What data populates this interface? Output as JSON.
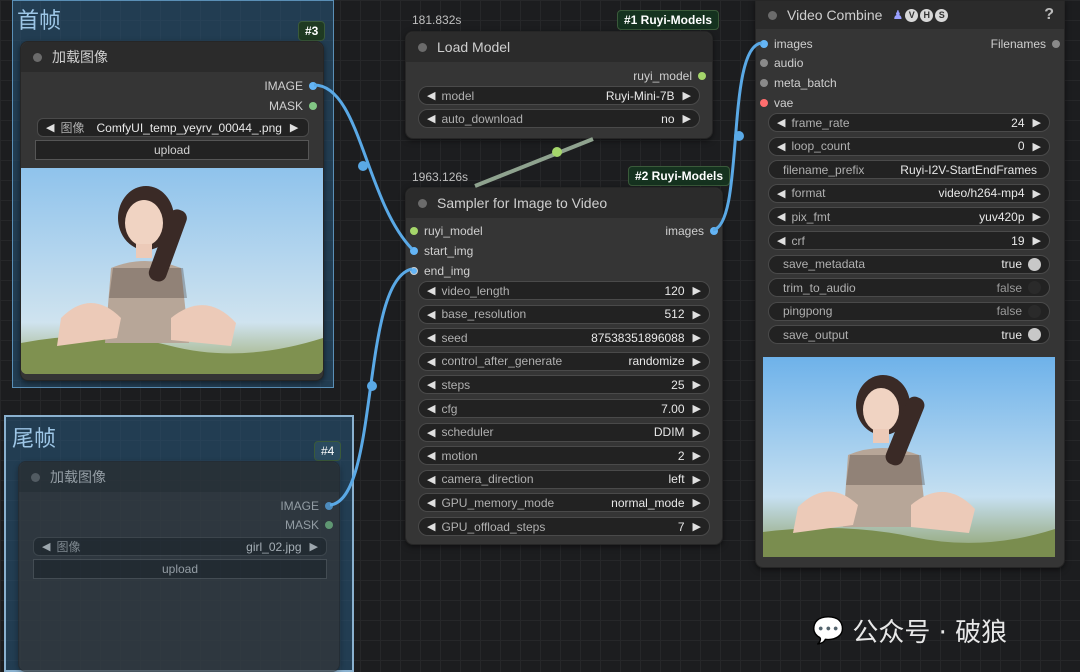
{
  "groups": {
    "first_frame": {
      "title": "首帧",
      "id_badge": "#3"
    },
    "last_frame": {
      "title": "尾帧",
      "id_badge": "#4"
    }
  },
  "load_image_1": {
    "title": "加载图像",
    "outputs": [
      "IMAGE",
      "MASK"
    ],
    "image_widget": {
      "label": "图像",
      "value": "ComfyUI_temp_yeyrv_00044_.png"
    },
    "upload_label": "upload"
  },
  "load_image_2": {
    "title": "加载图像",
    "outputs": [
      "IMAGE",
      "MASK"
    ],
    "image_widget": {
      "label": "图像",
      "value": "girl_02.jpg"
    },
    "upload_label": "upload"
  },
  "load_model": {
    "time": "181.832s",
    "badge": "#1 Ruyi-Models",
    "title": "Load Model",
    "output": "ruyi_model",
    "widgets": [
      {
        "label": "model",
        "value": "Ruyi-Mini-7B"
      },
      {
        "label": "auto_download",
        "value": "no"
      }
    ]
  },
  "sampler": {
    "time": "1963.126s",
    "badge": "#2 Ruyi-Models",
    "title": "Sampler for Image to Video",
    "inputs": [
      "ruyi_model",
      "start_img",
      "end_img"
    ],
    "output": "images",
    "widgets": [
      {
        "label": "video_length",
        "value": "120"
      },
      {
        "label": "base_resolution",
        "value": "512"
      },
      {
        "label": "seed",
        "value": "87538351896088"
      },
      {
        "label": "control_after_generate",
        "value": "randomize"
      },
      {
        "label": "steps",
        "value": "25"
      },
      {
        "label": "cfg",
        "value": "7.00"
      },
      {
        "label": "scheduler",
        "value": "DDIM"
      },
      {
        "label": "motion",
        "value": "2"
      },
      {
        "label": "camera_direction",
        "value": "left"
      },
      {
        "label": "GPU_memory_mode",
        "value": "normal_mode"
      },
      {
        "label": "GPU_offload_steps",
        "value": "7"
      }
    ]
  },
  "video_combine": {
    "title": "Video Combine",
    "badges": [
      "V",
      "H",
      "S"
    ],
    "help": "?",
    "inputs": [
      "images",
      "audio",
      "meta_batch",
      "vae"
    ],
    "output": "Filenames",
    "widgets": [
      {
        "label": "frame_rate",
        "value": "24",
        "kind": "number"
      },
      {
        "label": "loop_count",
        "value": "0",
        "kind": "number"
      },
      {
        "label": "filename_prefix",
        "value": "Ruyi-I2V-StartEndFrames",
        "kind": "text"
      },
      {
        "label": "format",
        "value": "video/h264-mp4",
        "kind": "combo"
      },
      {
        "label": "pix_fmt",
        "value": "yuv420p",
        "kind": "combo"
      },
      {
        "label": "crf",
        "value": "19",
        "kind": "number"
      },
      {
        "label": "save_metadata",
        "value": "true",
        "kind": "toggle"
      },
      {
        "label": "trim_to_audio",
        "value": "false",
        "kind": "toggle"
      },
      {
        "label": "pingpong",
        "value": "false",
        "kind": "toggle"
      },
      {
        "label": "save_output",
        "value": "true",
        "kind": "toggle"
      }
    ]
  },
  "watermark": {
    "text": "公众号 · 破狼"
  },
  "colors": {
    "image_port": "#64b5f6",
    "mask_port": "#81c784",
    "model_port": "#a5d66b",
    "vae_port": "#ff6e6e",
    "wire": "#5aa9e6"
  }
}
